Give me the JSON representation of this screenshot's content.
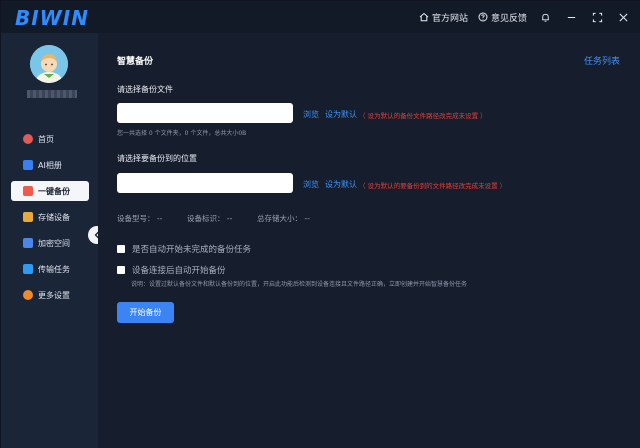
{
  "app": {
    "logo_text": "BIWIN",
    "website_label": "官方网站",
    "feedback_label": "意见反馈"
  },
  "sidebar": {
    "items": [
      {
        "label": "首页",
        "icon": "home-icon",
        "color": "#e25a55"
      },
      {
        "label": "AI相册",
        "icon": "ai-album-icon",
        "color": "#3a7ff0"
      },
      {
        "label": "一键备份",
        "icon": "backup-icon",
        "color": "#f05a4a"
      },
      {
        "label": "存储设备",
        "icon": "storage-icon",
        "color": "#e7a93a"
      },
      {
        "label": "加密空间",
        "icon": "folder-lock-icon",
        "color": "#4a87e8"
      },
      {
        "label": "传输任务",
        "icon": "transfer-icon",
        "color": "#2f9bf0"
      },
      {
        "label": "更多设置",
        "icon": "settings-icon",
        "color": "#f08a2e"
      }
    ],
    "active_index": 2
  },
  "main": {
    "title": "智慧备份",
    "task_list_label": "任务列表",
    "source": {
      "label": "请选择备份文件",
      "input_value": "",
      "browse_label": "浏览",
      "default_label": "设为默认",
      "warning": "（ 设为默认的备份文件路径改完成未设置 ）",
      "hint": "您一共选择 0 个文件夹，0 个文件，总共大小0B"
    },
    "target": {
      "label": "请选择要备份到的位置",
      "input_value": "",
      "browse_label": "浏览",
      "default_label": "设为默认",
      "warning": "（ 设为默认的要备份到的文件路径改完成未设置 ）"
    },
    "device_info": {
      "model": "设备型号： --",
      "id": "设备标识： --",
      "capacity": "总存储大小： --"
    },
    "options": [
      {
        "label": "是否自动开始未完成的备份任务",
        "checked": false
      },
      {
        "label": "设备连接后自动开始备份",
        "checked": false
      }
    ],
    "note": "说明：设置过默认备份文件和默认备份到的位置，开启此功能后检测到设备连接且文件路径正确，立即创建并开始智慧备份任务",
    "start_button": "开始备份"
  },
  "colors": {
    "accent": "#3a84f3",
    "warning": "#e0413c",
    "sidebar_bg": "#1b2538",
    "main_bg": "#161d2c"
  }
}
